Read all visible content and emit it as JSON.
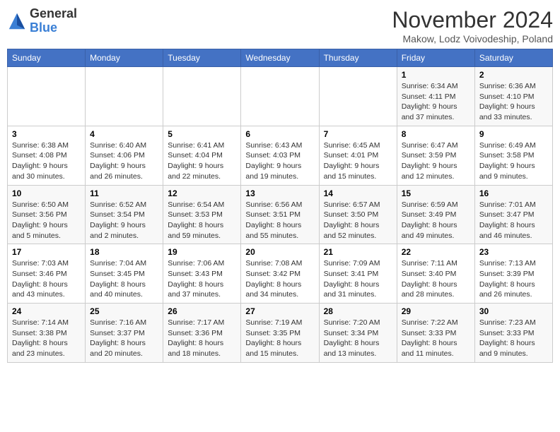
{
  "header": {
    "logo_general": "General",
    "logo_blue": "Blue",
    "month_title": "November 2024",
    "location": "Makow, Lodz Voivodeship, Poland"
  },
  "weekdays": [
    "Sunday",
    "Monday",
    "Tuesday",
    "Wednesday",
    "Thursday",
    "Friday",
    "Saturday"
  ],
  "weeks": [
    [
      {
        "day": "",
        "info": ""
      },
      {
        "day": "",
        "info": ""
      },
      {
        "day": "",
        "info": ""
      },
      {
        "day": "",
        "info": ""
      },
      {
        "day": "",
        "info": ""
      },
      {
        "day": "1",
        "info": "Sunrise: 6:34 AM\nSunset: 4:11 PM\nDaylight: 9 hours\nand 37 minutes."
      },
      {
        "day": "2",
        "info": "Sunrise: 6:36 AM\nSunset: 4:10 PM\nDaylight: 9 hours\nand 33 minutes."
      }
    ],
    [
      {
        "day": "3",
        "info": "Sunrise: 6:38 AM\nSunset: 4:08 PM\nDaylight: 9 hours\nand 30 minutes."
      },
      {
        "day": "4",
        "info": "Sunrise: 6:40 AM\nSunset: 4:06 PM\nDaylight: 9 hours\nand 26 minutes."
      },
      {
        "day": "5",
        "info": "Sunrise: 6:41 AM\nSunset: 4:04 PM\nDaylight: 9 hours\nand 22 minutes."
      },
      {
        "day": "6",
        "info": "Sunrise: 6:43 AM\nSunset: 4:03 PM\nDaylight: 9 hours\nand 19 minutes."
      },
      {
        "day": "7",
        "info": "Sunrise: 6:45 AM\nSunset: 4:01 PM\nDaylight: 9 hours\nand 15 minutes."
      },
      {
        "day": "8",
        "info": "Sunrise: 6:47 AM\nSunset: 3:59 PM\nDaylight: 9 hours\nand 12 minutes."
      },
      {
        "day": "9",
        "info": "Sunrise: 6:49 AM\nSunset: 3:58 PM\nDaylight: 9 hours\nand 9 minutes."
      }
    ],
    [
      {
        "day": "10",
        "info": "Sunrise: 6:50 AM\nSunset: 3:56 PM\nDaylight: 9 hours\nand 5 minutes."
      },
      {
        "day": "11",
        "info": "Sunrise: 6:52 AM\nSunset: 3:54 PM\nDaylight: 9 hours\nand 2 minutes."
      },
      {
        "day": "12",
        "info": "Sunrise: 6:54 AM\nSunset: 3:53 PM\nDaylight: 8 hours\nand 59 minutes."
      },
      {
        "day": "13",
        "info": "Sunrise: 6:56 AM\nSunset: 3:51 PM\nDaylight: 8 hours\nand 55 minutes."
      },
      {
        "day": "14",
        "info": "Sunrise: 6:57 AM\nSunset: 3:50 PM\nDaylight: 8 hours\nand 52 minutes."
      },
      {
        "day": "15",
        "info": "Sunrise: 6:59 AM\nSunset: 3:49 PM\nDaylight: 8 hours\nand 49 minutes."
      },
      {
        "day": "16",
        "info": "Sunrise: 7:01 AM\nSunset: 3:47 PM\nDaylight: 8 hours\nand 46 minutes."
      }
    ],
    [
      {
        "day": "17",
        "info": "Sunrise: 7:03 AM\nSunset: 3:46 PM\nDaylight: 8 hours\nand 43 minutes."
      },
      {
        "day": "18",
        "info": "Sunrise: 7:04 AM\nSunset: 3:45 PM\nDaylight: 8 hours\nand 40 minutes."
      },
      {
        "day": "19",
        "info": "Sunrise: 7:06 AM\nSunset: 3:43 PM\nDaylight: 8 hours\nand 37 minutes."
      },
      {
        "day": "20",
        "info": "Sunrise: 7:08 AM\nSunset: 3:42 PM\nDaylight: 8 hours\nand 34 minutes."
      },
      {
        "day": "21",
        "info": "Sunrise: 7:09 AM\nSunset: 3:41 PM\nDaylight: 8 hours\nand 31 minutes."
      },
      {
        "day": "22",
        "info": "Sunrise: 7:11 AM\nSunset: 3:40 PM\nDaylight: 8 hours\nand 28 minutes."
      },
      {
        "day": "23",
        "info": "Sunrise: 7:13 AM\nSunset: 3:39 PM\nDaylight: 8 hours\nand 26 minutes."
      }
    ],
    [
      {
        "day": "24",
        "info": "Sunrise: 7:14 AM\nSunset: 3:38 PM\nDaylight: 8 hours\nand 23 minutes."
      },
      {
        "day": "25",
        "info": "Sunrise: 7:16 AM\nSunset: 3:37 PM\nDaylight: 8 hours\nand 20 minutes."
      },
      {
        "day": "26",
        "info": "Sunrise: 7:17 AM\nSunset: 3:36 PM\nDaylight: 8 hours\nand 18 minutes."
      },
      {
        "day": "27",
        "info": "Sunrise: 7:19 AM\nSunset: 3:35 PM\nDaylight: 8 hours\nand 15 minutes."
      },
      {
        "day": "28",
        "info": "Sunrise: 7:20 AM\nSunset: 3:34 PM\nDaylight: 8 hours\nand 13 minutes."
      },
      {
        "day": "29",
        "info": "Sunrise: 7:22 AM\nSunset: 3:33 PM\nDaylight: 8 hours\nand 11 minutes."
      },
      {
        "day": "30",
        "info": "Sunrise: 7:23 AM\nSunset: 3:33 PM\nDaylight: 8 hours\nand 9 minutes."
      }
    ]
  ]
}
